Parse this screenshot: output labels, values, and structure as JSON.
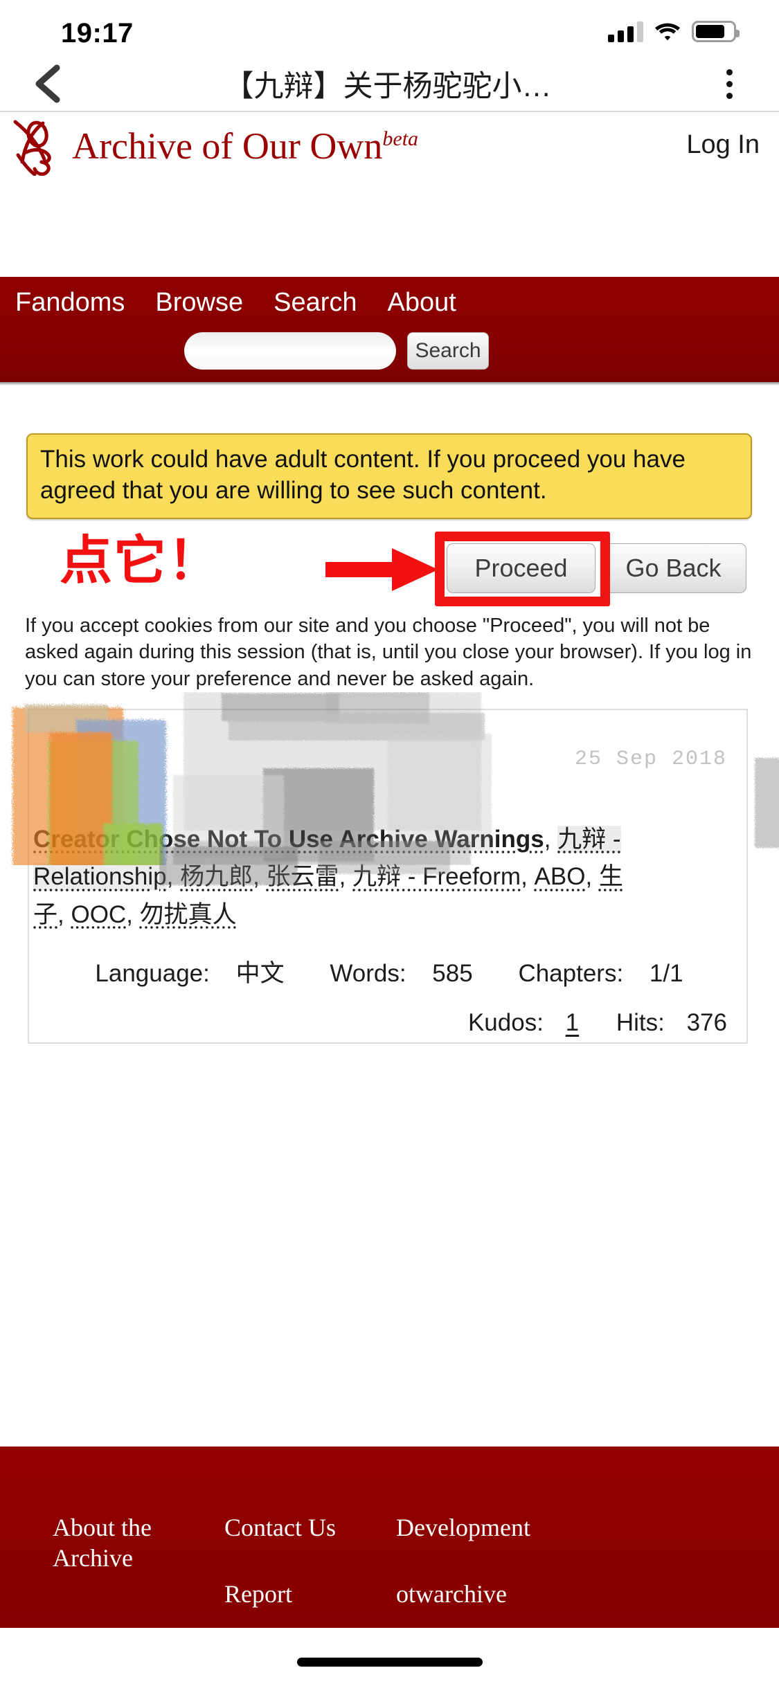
{
  "status_bar": {
    "time": "19:17",
    "signal_icon": "cellular-signal-icon",
    "wifi_icon": "wifi-icon",
    "battery_icon": "battery-icon"
  },
  "browser_toolbar": {
    "back_icon": "chevron-left-icon",
    "title": "【九辩】关于杨驼驼小…",
    "menu_icon": "more-vertical-icon"
  },
  "site_header": {
    "logo_icon": "ao3-logo-icon",
    "site_name": "Archive of Our Own",
    "beta_label": "beta",
    "login_label": "Log In"
  },
  "navbar": {
    "links": [
      {
        "label": "Fandoms"
      },
      {
        "label": "Browse"
      },
      {
        "label": "Search"
      },
      {
        "label": "About"
      }
    ],
    "search_value": "",
    "search_placeholder": "",
    "search_button": "Search",
    "background_color": "#8a0000"
  },
  "notice": {
    "text": "This work could have adult content. If you proceed you have agreed that you are willing to see such content.",
    "background_color": "#f8dc5a",
    "border_color": "#b99a25"
  },
  "actions": {
    "proceed_label": "Proceed",
    "go_back_label": "Go Back",
    "highlight_color": "#f01414"
  },
  "annotation": {
    "text": "点它！",
    "arrow_icon": "right-arrow-annotation-icon",
    "color": "#f31010"
  },
  "cookie_notice": {
    "text": "If you accept cookies from our site and you choose \"Proceed\", you will not be asked again during this session (that is, until you close your browser). If you log in you can store your preference and never be asked again."
  },
  "work_card": {
    "date": "25 Sep 2018",
    "tags": [
      {
        "label": "Creator Chose Not To Use Archive Warnings",
        "style": "warning"
      },
      {
        "label": "九辩 - Relationship",
        "style": "highlight"
      },
      {
        "label": "杨九郎",
        "style": "plain"
      },
      {
        "label": "张云雷",
        "style": "plain"
      },
      {
        "label": "九辩 - Freeform",
        "style": "plain"
      },
      {
        "label": "ABO",
        "style": "plain"
      },
      {
        "label": "生子",
        "style": "plain"
      },
      {
        "label": "OOC",
        "style": "plain"
      },
      {
        "label": "勿扰真人",
        "style": "plain"
      }
    ],
    "stats": {
      "language_label": "Language:",
      "language_value": "中文",
      "words_label": "Words:",
      "words_value": "585",
      "chapters_label": "Chapters:",
      "chapters_value": "1/1",
      "kudos_label": "Kudos:",
      "kudos_value": "1",
      "hits_label": "Hits:",
      "hits_value": "376"
    }
  },
  "footer": {
    "columns": [
      {
        "links": [
          "About the Archive"
        ]
      },
      {
        "links": [
          "Contact Us",
          "Report"
        ]
      },
      {
        "links": [
          "Development",
          "otwarchive"
        ]
      }
    ]
  }
}
